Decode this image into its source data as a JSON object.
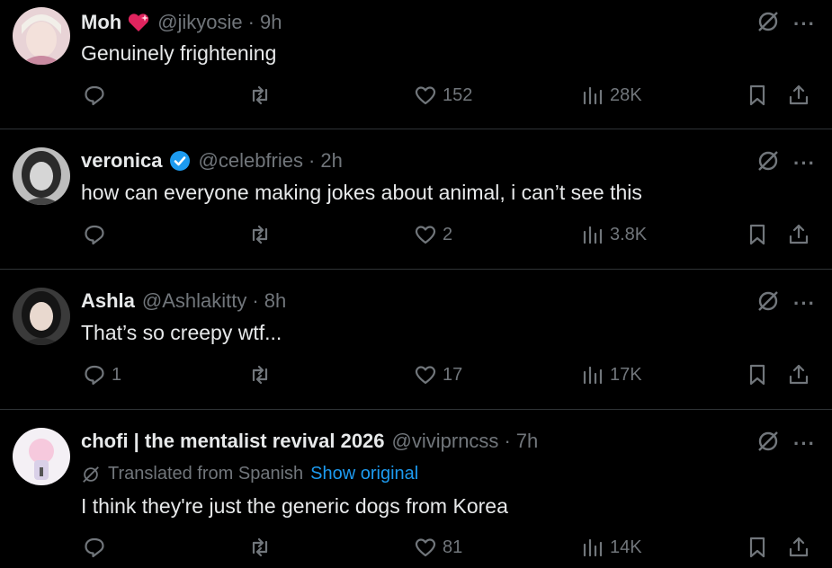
{
  "tweets": [
    {
      "name": "Moh",
      "badge": "heart-sparkle",
      "handle": "@jikyosie",
      "time": "9h",
      "text": "Genuinely frightening",
      "replies": "",
      "retweets": "",
      "likes": "152",
      "views": "28K"
    },
    {
      "name": "veronica",
      "badge": "verified",
      "handle": "@celebfries",
      "time": "2h",
      "text": "how can everyone making jokes about animal, i can’t see this",
      "replies": "",
      "retweets": "",
      "likes": "2",
      "views": "3.8K"
    },
    {
      "name": "Ashla",
      "badge": "",
      "handle": "@Ashlakitty",
      "time": "8h",
      "text": "That’s so creepy wtf...",
      "replies": "1",
      "retweets": "",
      "likes": "17",
      "views": "17K"
    },
    {
      "name": "chofi | the mentalist revival 2026",
      "badge": "",
      "handle": "@viviprncss",
      "time": "7h",
      "translated_label": "Translated from Spanish",
      "show_original": "Show original",
      "text": "I think they're just the generic dogs from Korea",
      "replies": "",
      "retweets": "",
      "likes": "81",
      "views": "14K"
    }
  ],
  "dot": "·",
  "more": "···",
  "colors": {
    "background": "#000000",
    "text": "#e7e9ea",
    "muted": "#71767b",
    "link": "#1d9bf0",
    "verified": "#1d9bf0",
    "heart": "#f91880"
  }
}
